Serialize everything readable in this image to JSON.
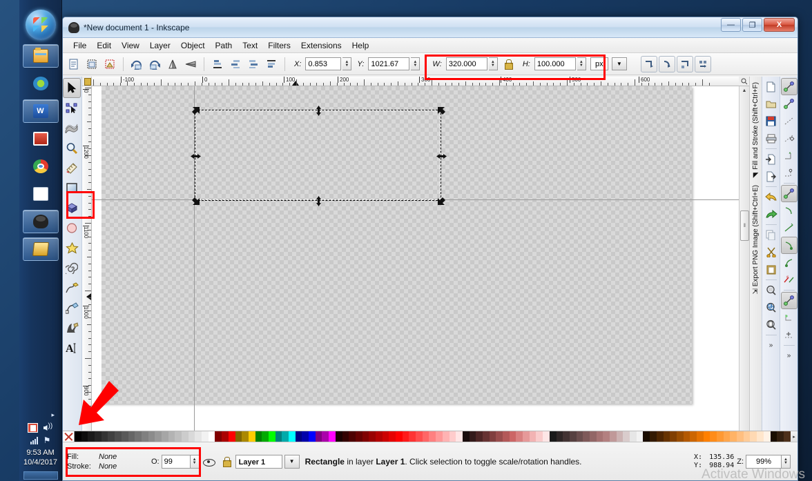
{
  "desktop": {
    "taskbar": {
      "start_label": "start-orb",
      "items": [
        {
          "name": "windows-explorer",
          "icon": "explorer-icon",
          "pinned": true
        },
        {
          "name": "media-player",
          "icon": "media-player-icon",
          "pinned": false
        },
        {
          "name": "microsoft-word",
          "icon": "word-icon",
          "label": "W",
          "pinned": true
        },
        {
          "name": "red-app",
          "icon": "red-app-icon",
          "pinned": false
        },
        {
          "name": "google-chrome",
          "icon": "chrome-icon",
          "pinned": false
        },
        {
          "name": "text-document",
          "icon": "document-icon",
          "pinned": false
        },
        {
          "name": "inkscape",
          "icon": "inkscape-icon",
          "pinned": true
        },
        {
          "name": "folders",
          "icon": "folders-icon",
          "pinned": true
        }
      ],
      "tray": {
        "overflow_arrow": "▸",
        "action_center": "action-center-icon",
        "volume": "speaker-icon",
        "network": "network-bars-icon",
        "flag": "flag-icon"
      },
      "clock": {
        "time": "9:53 AM",
        "date": "10/4/2017"
      }
    }
  },
  "window": {
    "title": "*New document 1 - Inkscape",
    "buttons": {
      "minimize": "—",
      "maximize": "❐",
      "close": "X"
    }
  },
  "menu": {
    "items": [
      "File",
      "Edit",
      "View",
      "Layer",
      "Object",
      "Path",
      "Text",
      "Filters",
      "Extensions",
      "Help"
    ]
  },
  "toolbar": {
    "x_label": "X:",
    "x_value": "0.853",
    "y_label": "Y:",
    "y_value": "1021.67",
    "w_label": "W:",
    "w_value": "320.000",
    "lock_icon": "lock-aspect-icon",
    "h_label": "H:",
    "h_value": "100.000",
    "unit": "px",
    "unit_dropdown": "▼",
    "spin_up": "▲",
    "spin_down": "▼",
    "left_buttons": [
      "select-all-icon",
      "select-all-layers-icon",
      "deselect-icon",
      "rotate-ccw-icon",
      "rotate-cw-icon",
      "flip-horizontal-icon",
      "flip-vertical-icon",
      "raise-to-top-icon",
      "raise-icon",
      "lower-icon",
      "lower-to-bottom-icon"
    ],
    "right_buttons": [
      "affect-transform-stroke-icon",
      "affect-transform-corners-icon",
      "affect-transform-gradients-icon",
      "affect-transform-patterns-icon"
    ]
  },
  "toolbox": {
    "tools": [
      {
        "name": "selector-tool",
        "icon": "arrow-pointer-icon",
        "active": true
      },
      {
        "name": "node-tool",
        "icon": "node-editor-icon",
        "active": false
      },
      {
        "name": "tweak-tool",
        "icon": "tweak-icon",
        "active": false
      },
      {
        "name": "zoom-tool",
        "icon": "magnifier-icon",
        "active": false
      },
      {
        "name": "measure-tool",
        "icon": "measure-icon",
        "active": false
      },
      {
        "name": "rectangle-tool",
        "icon": "rectangle-icon",
        "active": false
      },
      {
        "name": "3dbox-tool",
        "icon": "cube-icon",
        "active": false
      },
      {
        "name": "ellipse-tool",
        "icon": "ellipse-icon",
        "active": false
      },
      {
        "name": "star-tool",
        "icon": "star-icon",
        "active": false
      },
      {
        "name": "spiral-tool",
        "icon": "spiral-icon",
        "active": false
      },
      {
        "name": "pencil-tool",
        "icon": "pencil-icon",
        "active": false
      },
      {
        "name": "bezier-tool",
        "icon": "bezier-pen-icon",
        "active": false
      },
      {
        "name": "calligraphy-tool",
        "icon": "calligraphy-icon",
        "active": false
      },
      {
        "name": "text-tool",
        "icon": "text-A-icon",
        "active": false
      }
    ]
  },
  "rulers": {
    "horizontal_labels": [
      "-100",
      "0",
      "100",
      "200",
      "300",
      "400",
      "500",
      "600"
    ],
    "vertical_labels": [
      "0",
      "1200",
      "1100",
      "1000",
      "900"
    ],
    "unit": "px"
  },
  "canvas": {
    "selection_object": "rectangle-selection",
    "handle_icon": "scale-handle-icon"
  },
  "scrollbars": {
    "vertical_up": "▲",
    "vertical_down": "▼",
    "horizontal_left": "◀",
    "horizontal_right": "▶",
    "grip": "‖"
  },
  "docks": {
    "tabs": [
      {
        "name": "fill-and-stroke-dock",
        "label": "Fill and Stroke (Shift+Ctrl+F)",
        "icon": "fill-stroke-icon"
      },
      {
        "name": "export-png-dock",
        "label": "Export PNG Image (Shift+Ctrl+E)",
        "icon": "export-png-icon"
      }
    ],
    "command_buttons": [
      "new-document-icon",
      "open-document-icon",
      "save-document-icon",
      "print-icon",
      "import-icon",
      "export-icon",
      "undo-icon",
      "redo-icon",
      "copy-icon",
      "cut-icon",
      "paste-icon",
      "zoom-drawing-icon",
      "zoom-selection-icon",
      "zoom-page-icon"
    ],
    "snap_buttons": [
      "enable-snapping-icon",
      "snap-bounding-box-icon",
      "snap-bbox-edge-icon",
      "snap-bbox-corner-icon",
      "snap-bbox-edge-midpoint-icon",
      "snap-bbox-center-icon",
      "snap-nodes-icon",
      "snap-path-icon",
      "snap-path-intersection-icon",
      "snap-cusp-node-icon",
      "snap-smooth-node-icon",
      "snap-line-midpoint-icon",
      "snap-others-icon",
      "snap-object-center-icon",
      "snap-page-border-icon"
    ],
    "overflow": "»"
  },
  "palette": {
    "none_swatch": "none-x-swatch",
    "swatches": [
      "#000000",
      "#0d0d0d",
      "#1a1a1a",
      "#262626",
      "#333333",
      "#404040",
      "#4d4d4d",
      "#595959",
      "#666666",
      "#737373",
      "#808080",
      "#8c8c8c",
      "#999999",
      "#a6a6a6",
      "#b3b3b3",
      "#bfbfbf",
      "#cccccc",
      "#d9d9d9",
      "#e6e6e6",
      "#f2f2f2",
      "#ffffff",
      "#800000",
      "#aa0000",
      "#ff0000",
      "#806600",
      "#aa8800",
      "#ffcc00",
      "#008000",
      "#00aa00",
      "#00ff00",
      "#007f7f",
      "#00aaaa",
      "#00ffff",
      "#000080",
      "#0000aa",
      "#0000ff",
      "#800080",
      "#aa00aa",
      "#ff00ff",
      "#1a0000",
      "#330000",
      "#4d0000",
      "#660000",
      "#800000",
      "#990000",
      "#b30000",
      "#cc0000",
      "#e60000",
      "#ff0000",
      "#ff1a1a",
      "#ff3333",
      "#ff4d4d",
      "#ff6666",
      "#ff8080",
      "#ff9999",
      "#ffb3b3",
      "#ffcccc",
      "#ffe6e6",
      "#1a0d0d",
      "#331a1a",
      "#4d2626",
      "#663333",
      "#803f3f",
      "#994d4d",
      "#b35959",
      "#cc6666",
      "#d98080",
      "#e69999",
      "#f2b3b3",
      "#f9cccc",
      "#fde6e6",
      "#1a1a1a",
      "#2e2626",
      "#423333",
      "#564040",
      "#6a4d4d",
      "#7e5959",
      "#926666",
      "#a67373",
      "#b38080",
      "#c09999",
      "#ccb3b3",
      "#d9cccc",
      "#e6e6e6",
      "#f2f2f2",
      "#1a0d00",
      "#331a00",
      "#4d2600",
      "#663300",
      "#803f00",
      "#994d00",
      "#b35900",
      "#cc6600",
      "#e67300",
      "#ff8000",
      "#ff8c1a",
      "#ff9933",
      "#ffa64d",
      "#ffb366",
      "#ffbf80",
      "#ffcc99",
      "#ffd9b3",
      "#ffe6cc",
      "#fff2e6",
      "#1a0f00",
      "#33200f",
      "#4d301a"
    ],
    "scroll_arrow": "▸"
  },
  "status": {
    "fill_label": "Fill:",
    "fill_value": "None",
    "stroke_label": "Stroke:",
    "stroke_value": "None",
    "opacity_label": "O:",
    "opacity_value": "99",
    "visibility_icon": "eye-icon",
    "lock_icon": "layer-lock-icon",
    "layer_name": "Layer 1",
    "layer_dropdown": "▼",
    "message_object": "Rectangle",
    "message_mid": " in layer ",
    "message_layer": "Layer 1",
    "message_tail": ". Click selection to toggle scale/rotation handles.",
    "x_label": "X:",
    "x_value": "135.36",
    "y_label": "Y:",
    "y_value": "988.94",
    "zoom_label": "Z:",
    "zoom_value": "99%"
  },
  "watermark": "Activate Windows",
  "annotations": {
    "highlight_color": "#ff0000",
    "boxes": [
      {
        "name": "wh-fields-highlight"
      },
      {
        "name": "rectangle-tool-highlight"
      },
      {
        "name": "fill-stroke-opacity-highlight"
      }
    ],
    "arrow": {
      "name": "red-arrow-pointer"
    }
  }
}
